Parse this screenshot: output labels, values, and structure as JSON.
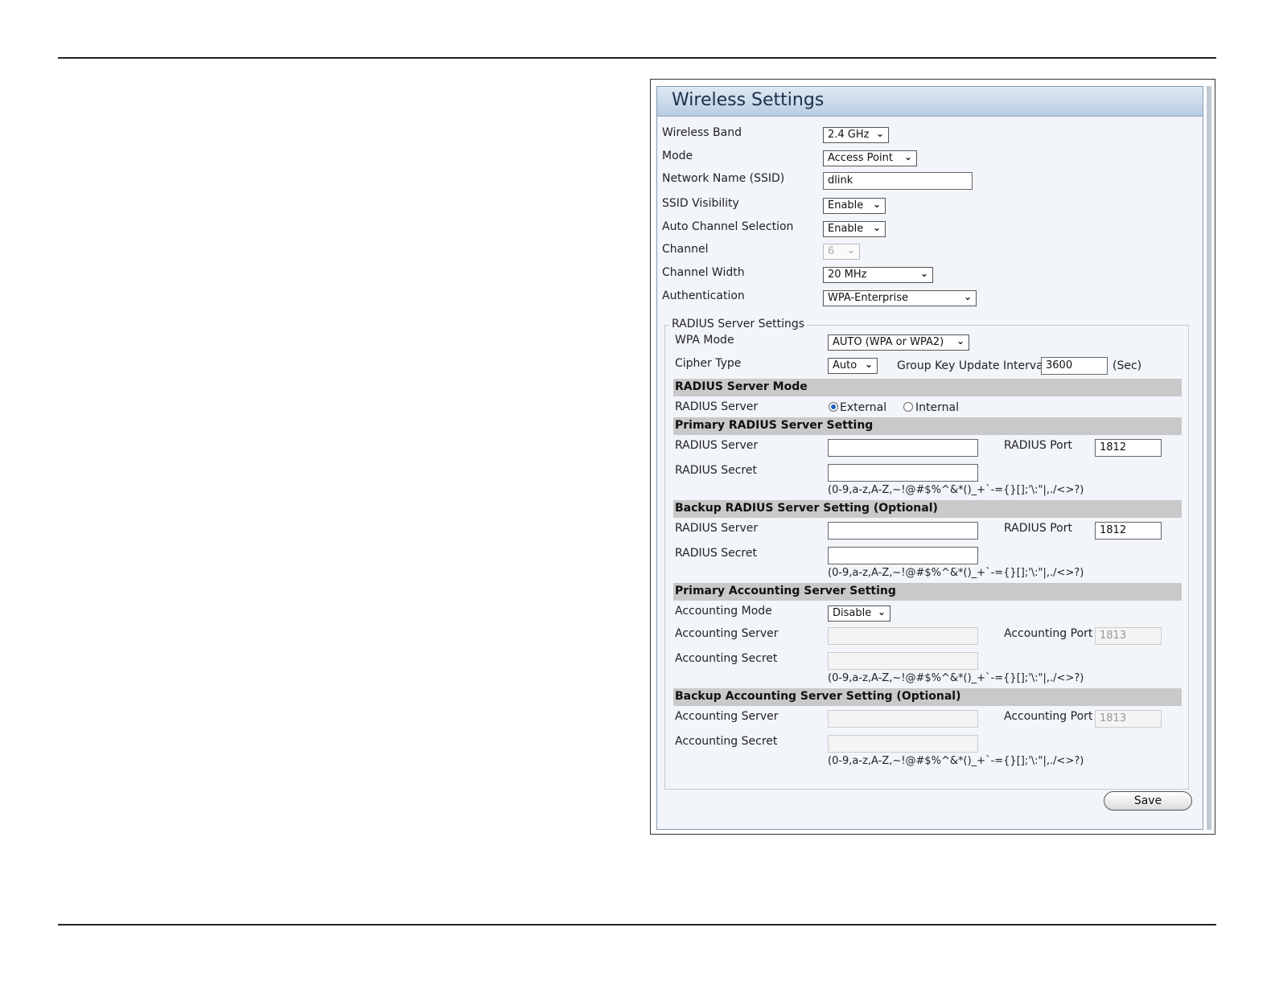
{
  "window": {
    "title": "Wireless Settings"
  },
  "fields": {
    "wireless_band": {
      "label": "Wireless Band",
      "value": "2.4 GHz"
    },
    "mode": {
      "label": "Mode",
      "value": "Access Point"
    },
    "ssid": {
      "label": "Network Name (SSID)",
      "value": "dlink"
    },
    "ssid_visibility": {
      "label": "SSID Visibility",
      "value": "Enable"
    },
    "auto_channel": {
      "label": "Auto Channel Selection",
      "value": "Enable"
    },
    "channel": {
      "label": "Channel",
      "value": "6"
    },
    "channel_width": {
      "label": "Channel Width",
      "value": "20 MHz"
    },
    "authentication": {
      "label": "Authentication",
      "value": "WPA-Enterprise"
    }
  },
  "radius": {
    "legend": "RADIUS Server Settings",
    "wpa_mode": {
      "label": "WPA Mode",
      "value": "AUTO (WPA or WPA2)"
    },
    "cipher_type": {
      "label": "Cipher Type",
      "value": "Auto"
    },
    "group_key": {
      "label": "Group Key Update Interval",
      "value": "3600",
      "unit": "(Sec)"
    },
    "server_mode": {
      "header": "RADIUS Server Mode",
      "label": "RADIUS Server",
      "options": [
        "External",
        "Internal"
      ],
      "selected": "External"
    },
    "primary": {
      "header": "Primary RADIUS Server Setting",
      "server_label": "RADIUS Server",
      "server_value": "",
      "port_label": "RADIUS Port",
      "port_value": "1812",
      "secret_label": "RADIUS Secret",
      "secret_value": "",
      "hint": "(0-9,a-z,A-Z,~!@#$%^&*()_+`-={}[];'\\:\"|,./<>?)"
    },
    "backup": {
      "header": "Backup RADIUS Server Setting (Optional)",
      "server_label": "RADIUS Server",
      "server_value": "",
      "port_label": "RADIUS Port",
      "port_value": "1812",
      "secret_label": "RADIUS Secret",
      "secret_value": "",
      "hint": "(0-9,a-z,A-Z,~!@#$%^&*()_+`-={}[];'\\:\"|,./<>?)"
    },
    "primary_accounting": {
      "header": "Primary Accounting Server Setting",
      "mode_label": "Accounting Mode",
      "mode_value": "Disable",
      "server_label": "Accounting Server",
      "server_value": "",
      "port_label": "Accounting Port",
      "port_value": "1813",
      "secret_label": "Accounting Secret",
      "secret_value": "",
      "hint": "(0-9,a-z,A-Z,~!@#$%^&*()_+`-={}[];'\\:\"|,./<>?)"
    },
    "backup_accounting": {
      "header": "Backup Accounting Server Setting (Optional)",
      "server_label": "Accounting Server",
      "server_value": "",
      "port_label": "Accounting Port",
      "port_value": "1813",
      "secret_label": "Accounting Secret",
      "secret_value": "",
      "hint": "(0-9,a-z,A-Z,~!@#$%^&*()_+`-={}[];'\\:\"|,./<>?)"
    }
  },
  "actions": {
    "save_label": "Save"
  },
  "icons": {
    "dropdown": "chevron-down-icon",
    "radio_on": "radio-selected-icon"
  },
  "colors": {
    "title_bar": "#b8cde2",
    "section_bar": "#c9c9c9",
    "panel_bg": "#f2f5f9"
  }
}
